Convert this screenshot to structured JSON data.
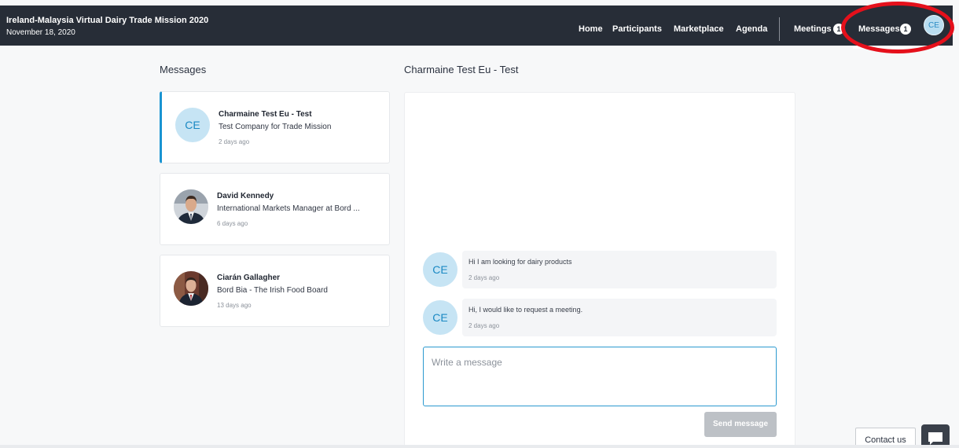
{
  "header": {
    "event_title": "Ireland-Malaysia Virtual Dairy Trade Mission 2020",
    "event_date": "November 18, 2020",
    "nav": {
      "home": "Home",
      "participants": "Participants",
      "marketplace": "Marketplace",
      "agenda": "Agenda",
      "meetings": "Meetings",
      "meetings_count": "1",
      "messages": "Messages",
      "messages_count": "1"
    },
    "user_initials": "CE"
  },
  "conversations": {
    "heading": "Messages",
    "items": [
      {
        "initials": "CE",
        "name": "Charmaine Test Eu - Test",
        "subtitle": "Test Company for Trade Mission",
        "time": "2 days ago"
      },
      {
        "name": "David Kennedy",
        "subtitle": "International Markets Manager at Bord ...",
        "time": "6 days ago"
      },
      {
        "name": "Ciarán Gallagher",
        "subtitle": "Bord Bia - The Irish Food Board",
        "time": "13 days ago"
      }
    ]
  },
  "thread": {
    "title": "Charmaine Test Eu - Test",
    "messages": [
      {
        "initials": "CE",
        "text": "Hi I am looking for dairy products",
        "time": "2 days ago"
      },
      {
        "initials": "CE",
        "text": "Hi, I would like to request a meeting.",
        "time": "2 days ago"
      }
    ],
    "compose_placeholder": "Write a message",
    "send_label": "Send message"
  },
  "support": {
    "contact_label": "Contact us"
  },
  "colors": {
    "topbar": "#272d37",
    "accent": "#1994d2",
    "avatar_bg": "#c6e4f4",
    "annotation": "#e5101b"
  }
}
